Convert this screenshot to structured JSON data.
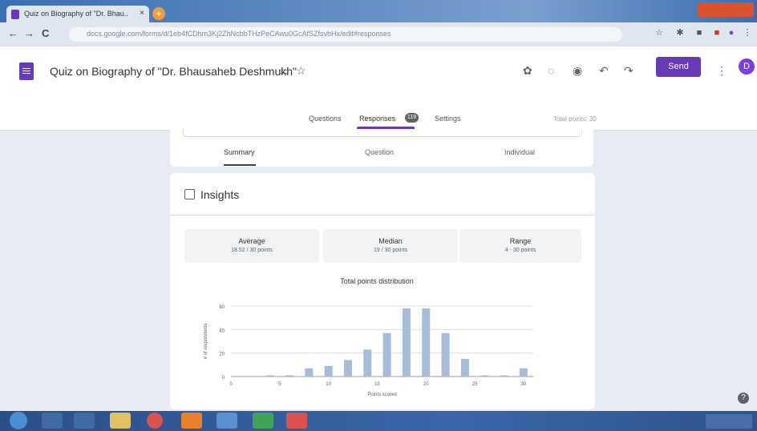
{
  "browser": {
    "tab_title": "Quiz on Biography of \"Dr. Bhau...",
    "tab_close": "×",
    "new_tab": "+",
    "back": "←",
    "forward": "→",
    "reload": "C",
    "url": "docs.google.com/forms/d/1eb4fCDhm3Kj2ZhNcbbTHzPeCAwu0GcAfSZfsvbHx/edit#responses"
  },
  "app": {
    "title": "Quiz on Biography of \"Dr. Bhausaheb Deshmukh\"",
    "send_label": "Send",
    "avatar_letter": "D",
    "tabs": [
      "Questions",
      "Responses",
      "Settings"
    ],
    "responses_count": "119",
    "total_points": "Total points: 30"
  },
  "responses": {
    "subtabs": [
      "Summary",
      "Question",
      "Individual"
    ]
  },
  "insights": {
    "title": "Insights",
    "stats": [
      {
        "label": "Average",
        "value": "18.52 / 30 points"
      },
      {
        "label": "Median",
        "value": "19 / 30 points"
      },
      {
        "label": "Range",
        "value": "4 - 30 points"
      }
    ]
  },
  "chart_data": {
    "type": "bar",
    "title": "Total points distribution",
    "xlabel": "Points scored",
    "ylabel": "# of respondents",
    "x": [
      4,
      6,
      8,
      10,
      12,
      14,
      16,
      18,
      20,
      22,
      24,
      26,
      28,
      30
    ],
    "values": [
      1,
      1,
      7,
      9,
      14,
      23,
      37,
      58,
      58,
      37,
      15,
      1,
      1,
      7
    ],
    "ylim": [
      0,
      60
    ],
    "yticks": [
      0,
      20,
      40,
      60
    ],
    "xticks": [
      0,
      5,
      10,
      15,
      20,
      25,
      30
    ],
    "xlim": [
      0,
      31
    ],
    "color": "#a6bcd8"
  },
  "colors": {
    "accent": "#673ab7",
    "page_bg": "#e6ebf4"
  }
}
